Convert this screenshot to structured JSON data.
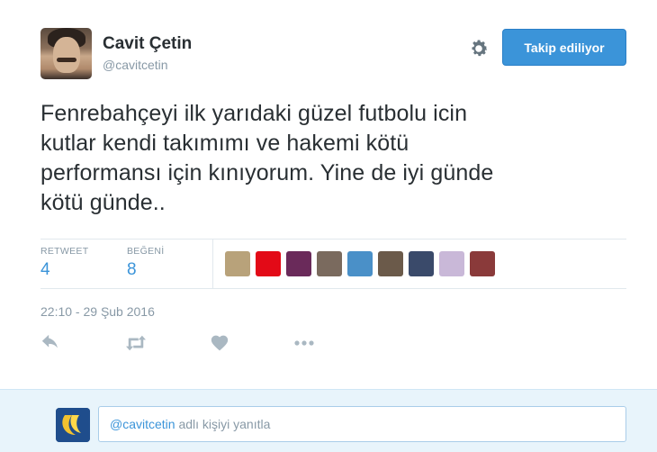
{
  "user": {
    "fullname": "Cavit Çetin",
    "username": "@cavitcetin"
  },
  "follow_button": {
    "label": "Takip ediliyor"
  },
  "tweet": {
    "text_lines": [
      "Fenrebahçeyi ilk yarıdaki güzel futbolu icin",
      "kutlar kendi takımımı ve hakemi kötü",
      "performansı için kınıyorum. Yine de iyi günde",
      "kötü günde.."
    ]
  },
  "stats": {
    "retweet_label": "RETWEET",
    "retweet_count": "4",
    "like_label": "BEĞENİ",
    "like_count": "8"
  },
  "likers": [
    {
      "color": "#b8a27a"
    },
    {
      "color": "#e30a17"
    },
    {
      "color": "#6a2a5a"
    },
    {
      "color": "#7a6a5e"
    },
    {
      "color": "#4a90c8"
    },
    {
      "color": "#6b5a4a"
    },
    {
      "color": "#3a4a6a"
    },
    {
      "color": "#c9b8d8"
    },
    {
      "color": "#8a3a3a"
    }
  ],
  "timestamp": "22:10 - 29 Şub 2016",
  "actions": [
    "reply-icon",
    "retweet-icon",
    "heart-icon",
    "more-icon"
  ],
  "reply": {
    "mention": "@cavitcetin",
    "prompt": " adlı kişiyi yanıtla"
  },
  "colors": {
    "accent": "#3b94d9",
    "muted": "#8899a6",
    "reply_bar_bg": "#e8f4fb"
  }
}
